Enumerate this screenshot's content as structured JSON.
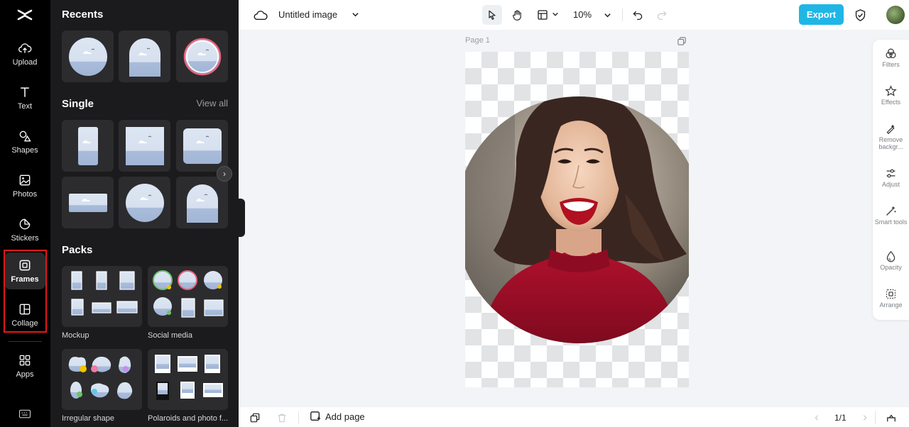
{
  "rail": {
    "items": [
      {
        "label": "Upload"
      },
      {
        "label": "Text"
      },
      {
        "label": "Shapes"
      },
      {
        "label": "Photos"
      },
      {
        "label": "Stickers"
      },
      {
        "label": "Frames"
      },
      {
        "label": "Collage"
      },
      {
        "label": "Apps"
      }
    ],
    "active": "Frames",
    "highlight_color": "#e0191b"
  },
  "panel": {
    "recents_title": "Recents",
    "single_title": "Single",
    "view_all": "View all",
    "packs_title": "Packs",
    "packs": [
      {
        "label": "Mockup"
      },
      {
        "label": "Social media"
      },
      {
        "label": "Irregular shape"
      },
      {
        "label": "Polaroids and photo f..."
      }
    ]
  },
  "topbar": {
    "doc_title": "Untitled image",
    "zoom": "10%",
    "export_label": "Export",
    "accent_color": "#1fb6e6"
  },
  "canvas": {
    "page_label": "Page 1"
  },
  "tools": [
    {
      "label": "Filters"
    },
    {
      "label": "Effects"
    },
    {
      "label": "Remove backgr..."
    },
    {
      "label": "Adjust"
    },
    {
      "label": "Smart tools"
    },
    {
      "label": "Opacity"
    },
    {
      "label": "Arrange"
    }
  ],
  "bottombar": {
    "add_page": "Add page",
    "page_indicator": "1/1"
  }
}
